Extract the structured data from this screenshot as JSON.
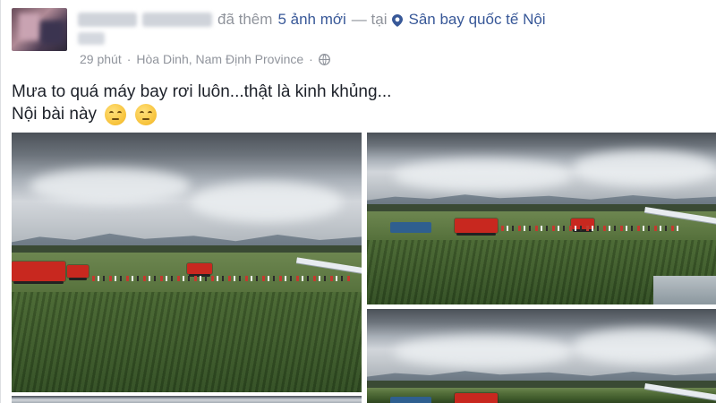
{
  "post": {
    "author_name": "",
    "action_text": "đã thêm",
    "action_count": "5 ảnh mới",
    "separator": "— tại",
    "location": "Sân bay quốc tế Nội",
    "time": "29 phút",
    "place": "Hòa Dinh, Nam Định Province",
    "dot": "·",
    "text_line1": "Mưa to quá máy bay rơi luôn...thật là kinh khủng...",
    "text_line2": "Nội bài này"
  },
  "icons": {
    "location": "map-pin-icon",
    "privacy": "globe-icon",
    "emoji": "unamused-face-icon"
  },
  "colors": {
    "link": "#385898",
    "meta": "#90949c",
    "text": "#1d2129"
  }
}
